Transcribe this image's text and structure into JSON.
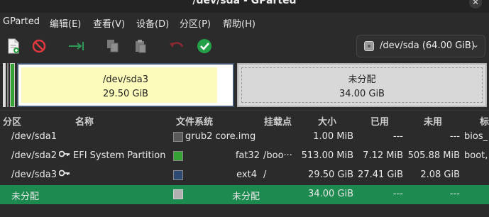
{
  "window": {
    "title": "/dev/sda - GParted"
  },
  "menu": [
    {
      "label": "GParted"
    },
    {
      "label": "编辑(E)"
    },
    {
      "label": "查看(V)"
    },
    {
      "label": "设备(D)"
    },
    {
      "label": "分区(P)"
    },
    {
      "label": "帮助(H)"
    }
  ],
  "toolbar": {
    "icons": [
      "new-partition-icon",
      "delete-icon",
      "resize-move-icon",
      "copy-icon",
      "paste-icon",
      "undo-icon",
      "apply-icon"
    ]
  },
  "device_selector": {
    "label": "/dev/sda (64.00 GiB)",
    "icon": "disk-icon"
  },
  "visual": {
    "sda3": {
      "name": "/dev/sda3",
      "size": "29.50 GiB",
      "color": "#41566e"
    },
    "unallocated": {
      "name": "未分配",
      "size": "34.00 GiB"
    }
  },
  "columns": [
    "分区",
    "名称",
    "文件系统",
    "挂载点",
    "大小",
    "已用",
    "未用",
    "标"
  ],
  "rows": [
    {
      "partition": "/dev/sda1",
      "key": false,
      "name": "",
      "fs_color": "#5a5a5a",
      "fs": "grub2 core.img",
      "mount": "",
      "size": "1.00 MiB",
      "used": "---",
      "unused": "---",
      "flags": "bios_"
    },
    {
      "partition": "/dev/sda2",
      "key": true,
      "name": "EFI System Partition",
      "fs_color": "#34a334",
      "fs": "fat32",
      "mount": "/boo···",
      "size": "513.00 MiB",
      "used": "7.12 MiB",
      "unused": "505.88 MiB",
      "flags": "boot,"
    },
    {
      "partition": "/dev/sda3",
      "key": true,
      "name": "",
      "fs_color": "#2e4a72",
      "fs": "ext4",
      "mount": "/",
      "size": "29.50 GiB",
      "used": "27.41 GiB",
      "unused": "2.08 GiB",
      "flags": ""
    },
    {
      "partition": "未分配",
      "key": false,
      "name": "",
      "fs_color": "#b0b0b0",
      "fs": "未分配",
      "mount": "",
      "size": "34.00 GiB",
      "used": "---",
      "unused": "---",
      "flags": "",
      "selected": true
    }
  ]
}
